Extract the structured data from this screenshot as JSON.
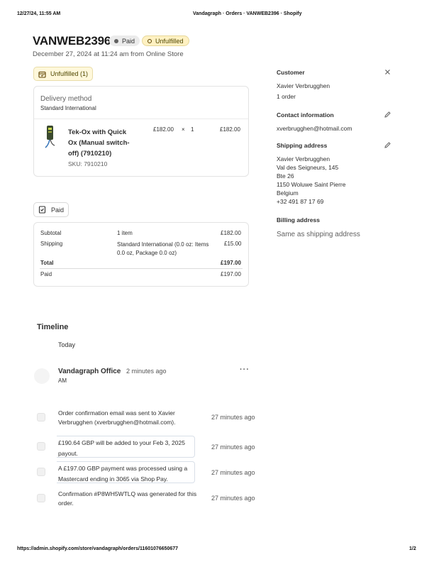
{
  "print_header": {
    "datetime": "12/27/24, 11:55 AM",
    "page_title": "Vandagraph · Orders · VANWEB2396 · Shopify"
  },
  "order": {
    "number": "VANWEB2396",
    "payment_badge": "Paid",
    "fulfillment_badge": "Unfulfilled",
    "date_line": "December 27, 2024 at 11:24 am from Online Store"
  },
  "fulfillment": {
    "chip_label": "Unfulfilled (1)",
    "delivery_method_label": "Delivery method",
    "delivery_method_value": "Standard International",
    "item": {
      "name_line1": "Tek-Ox with Quick",
      "name_line2": "Ox (Manual switch-",
      "name_line3": "off) (7910210)",
      "sku": "SKU: 7910210",
      "unit_price": "£182.00",
      "times": "×",
      "quantity": "1",
      "total": "£182.00"
    }
  },
  "payment": {
    "chip_label": "Paid",
    "subtotal_label": "Subtotal",
    "subtotal_detail": "1 item",
    "subtotal_value": "£182.00",
    "shipping_label": "Shipping",
    "shipping_detail_line1": "Standard International (0.0 oz: Items",
    "shipping_detail_line2": "0.0 oz, Package 0.0 oz)",
    "shipping_value": "£15.00",
    "total_label": "Total",
    "total_value": "£197.00",
    "paid_label": "Paid",
    "paid_value": "£197.00"
  },
  "customer": {
    "title": "Customer",
    "name": "Xavier Verbrugghen",
    "orders": "1 order",
    "contact_title": "Contact information",
    "email": "xverbrugghen@hotmail.com",
    "shipping_title": "Shipping address",
    "address": [
      "Xavier Verbrugghen",
      "Val des Seigneurs, 145",
      "Bte 26",
      "1150 Woluwe Saint Pierre",
      "Belgium",
      "+32 491 87 17 69"
    ],
    "billing_title": "Billing address",
    "billing_value": "Same as shipping address"
  },
  "timeline": {
    "title": "Timeline",
    "today": "Today",
    "comment_author": "Vandagraph Office",
    "comment_time": "2 minutes ago",
    "comment_avatar": "AM",
    "events": [
      {
        "line1": "Order confirmation email was sent to Xavier",
        "line2": "Verbrugghen (xverbrugghen@hotmail.com).",
        "time": "27 minutes ago"
      },
      {
        "line1": "£190.64 GBP will be added to your Feb 3, 2025",
        "line2": "payout.",
        "time": "27 minutes ago"
      },
      {
        "line1": "A £197.00 GBP payment was processed using a",
        "line2": "Mastercard ending in 3065 via Shop Pay.",
        "time": "27 minutes ago"
      },
      {
        "line1": "Confirmation #P8WH5WTLQ was generated for this",
        "line2": "order.",
        "time": "27 minutes ago"
      }
    ]
  },
  "print_footer": {
    "url": "https://admin.shopify.com/store/vandagraph/orders/11601076650677",
    "page": "1/2"
  },
  "colors": {
    "paid_badge_bg": "#ebebeb",
    "unfulfilled_badge_bg": "#fff1c2",
    "unfulfilled_chip_bg": "#fff8db"
  }
}
